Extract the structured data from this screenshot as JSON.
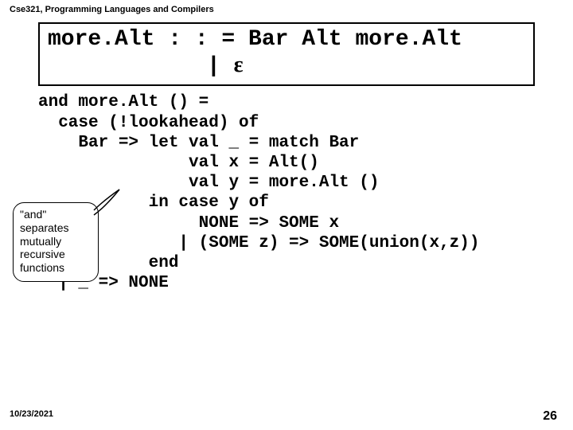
{
  "header": "Cse321, Programming Languages and Compilers",
  "grammar": {
    "line1": "more.Alt : : = Bar Alt more.Alt",
    "line2_prefix": "| ",
    "epsilon": "ε"
  },
  "code": "and more.Alt () =\n  case (!lookahead) of\n    Bar => let val _ = match Bar\n               val x = Alt()\n               val y = more.Alt ()\n           in case y of\n                NONE => SOME x\n              | (SOME z) => SOME(union(x,z))\n           end\n  | _ => NONE",
  "callout": {
    "quoted": "\"and\"",
    "rest": " separates mutually recursive functions"
  },
  "footer": {
    "date": "10/23/2021",
    "page": "26"
  }
}
